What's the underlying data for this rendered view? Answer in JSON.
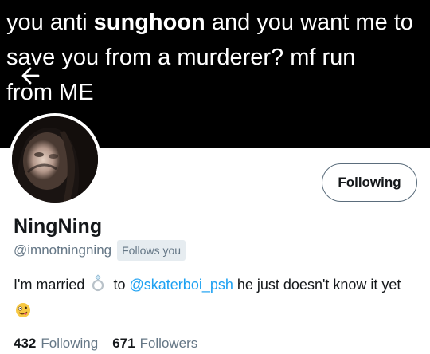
{
  "banner": {
    "line1_pre": "you anti ",
    "line1_bold": "sunghoon",
    "line1_post": " and you want me to",
    "line2": "save you from a murderer? mf run",
    "line3": "from ME"
  },
  "profile": {
    "follow_button_label": "Following",
    "display_name": "NingNing",
    "handle": "@imnotningning",
    "follows_you_badge": "Follows you",
    "bio": {
      "text_before": "I'm married",
      "emoji_1": "ring-icon",
      "text_to": "to",
      "mention": "@skaterboi_psh",
      "text_after": "he just doesn't know it yet",
      "emoji_2": "zany-face-icon"
    },
    "stats": {
      "following_count": "432",
      "following_label": "Following",
      "followers_count": "671",
      "followers_label": "Followers"
    }
  },
  "colors": {
    "header_bg": "#000000",
    "link": "#1da1f2",
    "muted": "#657786",
    "text": "#14171a"
  }
}
